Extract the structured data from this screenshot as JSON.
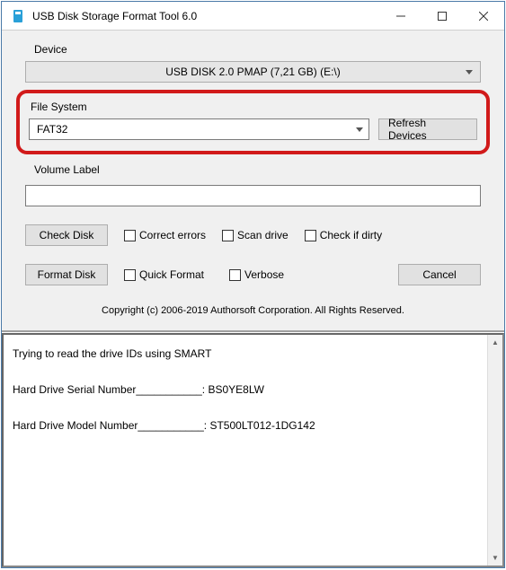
{
  "titlebar": {
    "title": "USB Disk Storage Format Tool 6.0"
  },
  "labels": {
    "device": "Device",
    "file_system": "File System",
    "volume_label": "Volume Label"
  },
  "device": {
    "selected": "USB DISK 2.0  PMAP (7,21 GB) (E:\\)"
  },
  "file_system": {
    "selected": "FAT32"
  },
  "buttons": {
    "refresh": "Refresh Devices",
    "check_disk": "Check Disk",
    "format_disk": "Format Disk",
    "cancel": "Cancel"
  },
  "checkboxes": {
    "correct_errors": "Correct errors",
    "scan_drive": "Scan drive",
    "check_if_dirty": "Check if dirty",
    "quick_format": "Quick Format",
    "verbose": "Verbose"
  },
  "volume_label_value": "",
  "copyright": "Copyright (c) 2006-2019 Authorsoft Corporation. All Rights Reserved.",
  "log": {
    "line1": "Trying to read the drive IDs using SMART",
    "line2": "Hard Drive Serial Number___________: BS0YE8LW",
    "line3": "Hard Drive Model Number___________: ST500LT012-1DG142"
  }
}
